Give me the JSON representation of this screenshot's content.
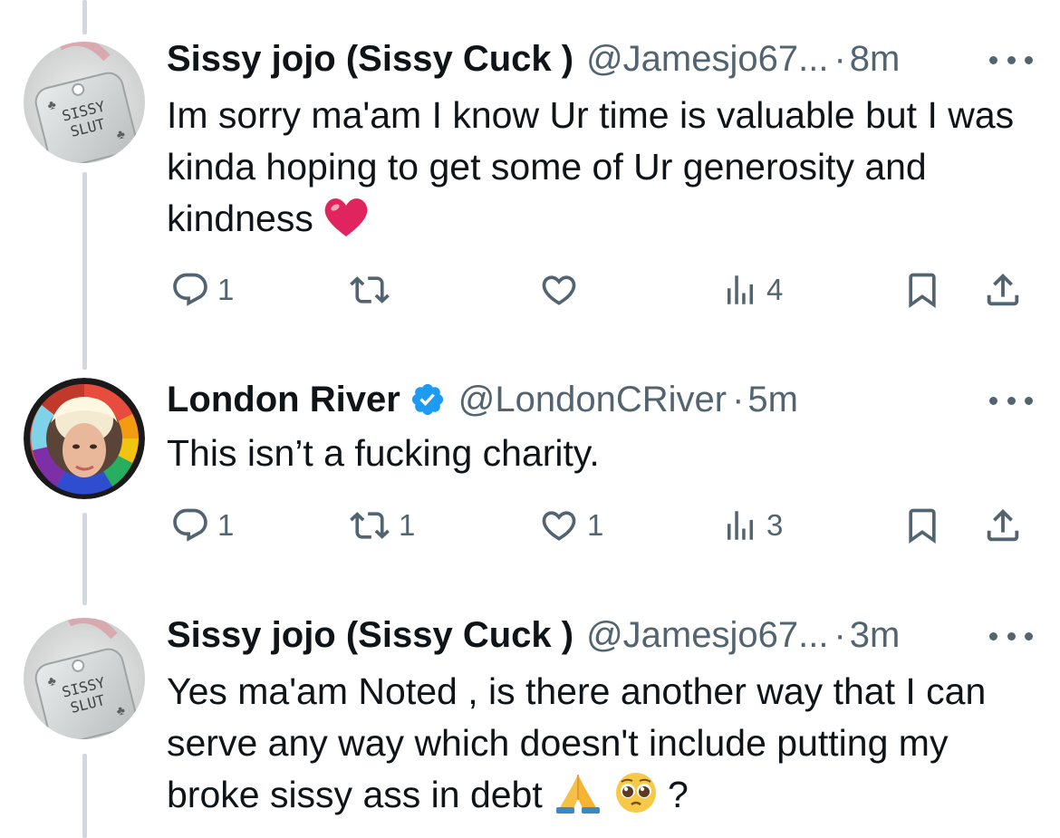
{
  "tweets": [
    {
      "name": "Sissy jojo (Sissy Cuck )",
      "handle": "@Jamesjo67...",
      "separator": "·",
      "time": "8m",
      "avatar_text": [
        "SISSY",
        "SLUT"
      ],
      "text": "Im sorry ma'am I know Ur time is valuable but I was kinda hoping to get some of Ur generosity and kindness",
      "emoji": "red-heart",
      "verified": false,
      "stats": {
        "replies": "1",
        "reposts": "",
        "likes": "",
        "views": "4"
      }
    },
    {
      "name": "London River",
      "handle": "@LondonCRiver",
      "separator": "·",
      "time": "5m",
      "text": "This isn’t a fucking charity.",
      "verified": true,
      "stats": {
        "replies": "1",
        "reposts": "1",
        "likes": "1",
        "views": "3"
      }
    },
    {
      "name": "Sissy jojo (Sissy Cuck )",
      "handle": "@Jamesjo67...",
      "separator": "·",
      "time": "3m",
      "avatar_text": [
        "SISSY",
        "SLUT"
      ],
      "text": "Yes ma'am Noted , is there another way that I can serve any way which doesn't include putting my broke sissy ass in debt",
      "text_end": "?",
      "emoji": [
        "folded-hands",
        "pleading-face"
      ],
      "verified": false
    }
  ],
  "icons": {
    "reply": "reply-icon",
    "repost": "repost-icon",
    "like": "like-icon",
    "views": "views-icon",
    "bookmark": "bookmark-icon",
    "share": "share-icon",
    "more": "more-icon",
    "verified": "verified-icon"
  },
  "colors": {
    "text": "#0f1419",
    "secondary": "#536471",
    "thread_line": "#cfd9de",
    "verified": "#1d9bf0",
    "heart_emoji": "#e0245e"
  }
}
